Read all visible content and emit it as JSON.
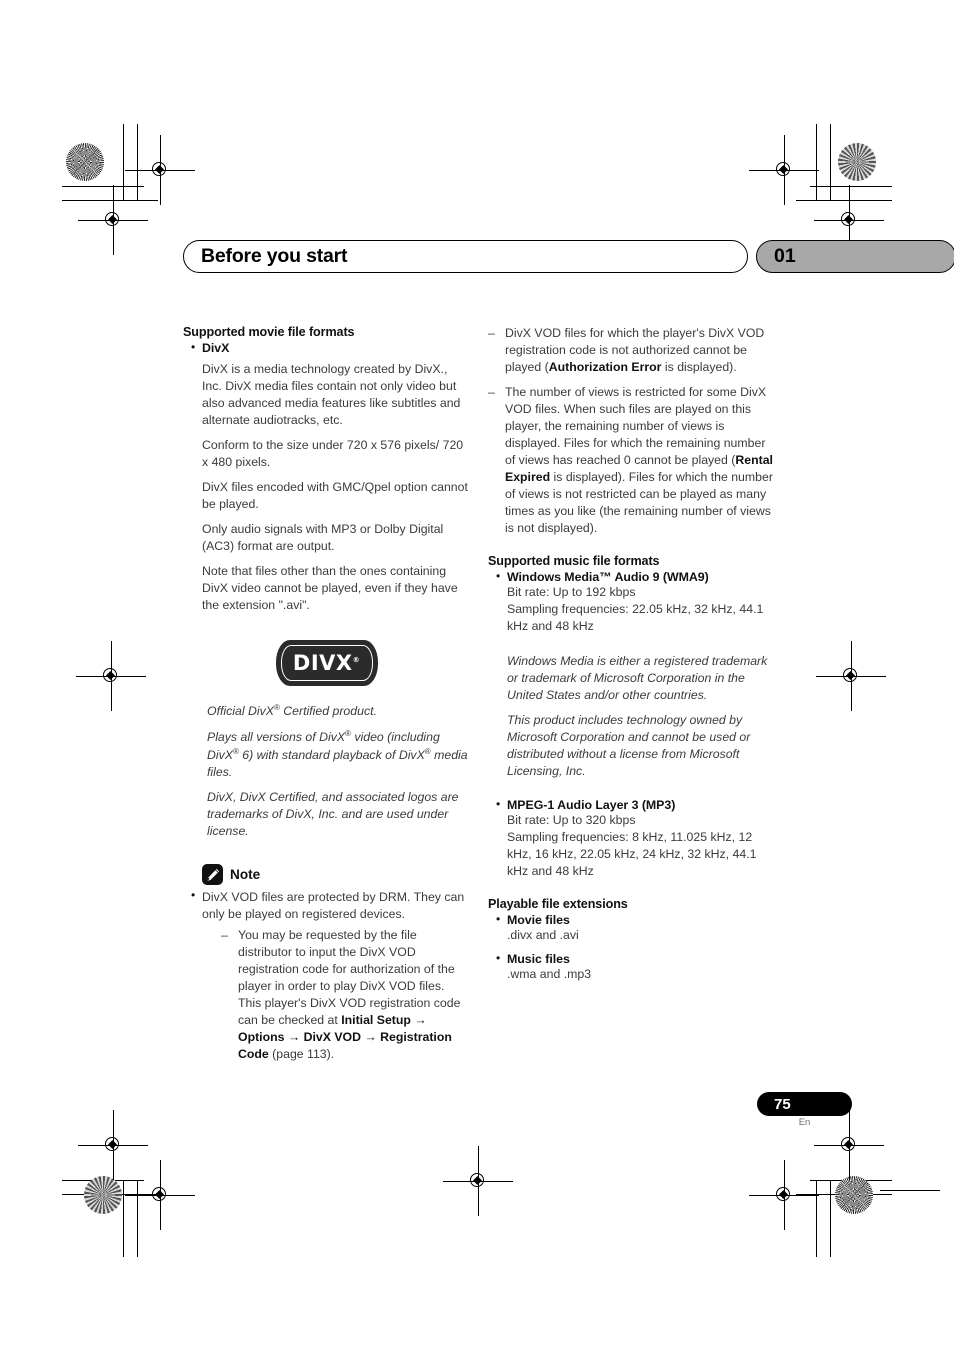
{
  "header": {
    "chapter_title": "Before you start",
    "chapter_number": "01"
  },
  "footer": {
    "page_number": "75",
    "language": "En"
  },
  "left_column": {
    "movie_formats_heading": "Supported movie file formats",
    "divx_label": "DivX",
    "paragraphs": [
      "DivX is a media technology created by DivX., Inc. DivX media files contain not only video but also advanced media features like subtitles and alternate audiotracks, etc.",
      "Conform to the size under 720 x 576 pixels/ 720 x 480 pixels.",
      "DivX files encoded with GMC/Qpel option cannot be played.",
      "Only audio signals with MP3 or Dolby Digital (AC3) format are output.",
      "Note that files other than the ones containing DivX video cannot be played, even if they have the extension \".avi\"."
    ],
    "logo_text": "DIVX",
    "logo_reg": "®",
    "legal_1_a": "Official DivX",
    "legal_1_b": " Certified product.",
    "legal_2_a": "Plays all versions of DivX",
    "legal_2_b": " video (including DivX",
    "legal_2_c": " 6) with standard playback of DivX",
    "legal_2_d": " media files.",
    "legal_3": "DivX, DivX Certified, and associated logos are trademarks of DivX, Inc. and are used under license.",
    "note_label": "Note",
    "note_bullet": "DivX VOD files are protected by DRM. They can only be played on registered devices.",
    "note_sub_a": "You may be requested by the file distributor to input the DivX VOD registration code for authorization of the player in order to play DivX VOD files. This player's DivX VOD registration code can be checked at ",
    "note_sub_path": "Initial Setup → Options → DivX VOD → Registration Code",
    "note_sub_b": " (page 113)."
  },
  "right_column": {
    "vod_item_1_a": "DivX VOD files for which the player's DivX VOD registration code is not authorized cannot be played (",
    "vod_item_1_bold": "Authorization Error",
    "vod_item_1_b": " is displayed).",
    "vod_item_2_a": "The number of views is restricted for some DivX VOD files. When such files are played on this player, the remaining number of views is displayed. Files for which the remaining number of views has reached 0 cannot be played (",
    "vod_item_2_bold": "Rental Expired",
    "vod_item_2_b": " is displayed). Files for which the number of views is not restricted can be played as many times as you like (the remaining number of views is not displayed).",
    "music_formats_heading": "Supported music file formats",
    "wma_label": "Windows Media™ Audio 9 (WMA9)",
    "wma_bitrate": "Bit rate: Up to 192 kbps",
    "wma_sampling": "Sampling frequencies: 22.05 kHz, 32 kHz, 44.1 kHz and 48 kHz",
    "ms_legal_1": "Windows Media is either a registered trademark or trademark of Microsoft Corporation in the United States and/or other countries.",
    "ms_legal_2": "This product includes technology owned by Microsoft Corporation and cannot be used or distributed without a license from Microsoft Licensing, Inc.",
    "mp3_label": "MPEG-1 Audio Layer 3 (MP3)",
    "mp3_bitrate": "Bit rate: Up to 320 kbps",
    "mp3_sampling": "Sampling frequencies: 8 kHz, 11.025 kHz, 12 kHz, 16 kHz, 22.05 kHz, 24 kHz, 32 kHz, 44.1 kHz and 48 kHz",
    "extensions_heading": "Playable file extensions",
    "movie_files_label": "Movie files",
    "movie_files_value": ".divx and .avi",
    "music_files_label": "Music files",
    "music_files_value": ".wma and .mp3"
  }
}
